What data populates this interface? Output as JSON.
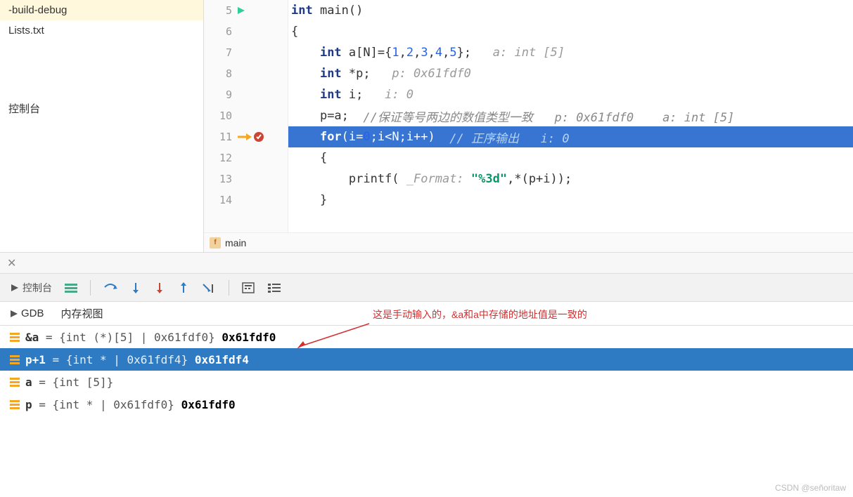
{
  "sidebar": {
    "items": [
      "-build-debug",
      "Lists.txt"
    ],
    "console_label": "控制台"
  },
  "code": {
    "lines": [
      {
        "num": 5,
        "indent": 0,
        "run": true,
        "parts": [
          {
            "t": "kw",
            "v": "int"
          },
          {
            "t": "",
            "v": " main()"
          }
        ]
      },
      {
        "num": 6,
        "indent": 0,
        "parts": [
          {
            "t": "",
            "v": "{"
          }
        ]
      },
      {
        "num": 7,
        "indent": 1,
        "parts": [
          {
            "t": "kw",
            "v": "int"
          },
          {
            "t": "",
            "v": " a[N]={"
          },
          {
            "t": "num",
            "v": "1"
          },
          {
            "t": "",
            "v": ","
          },
          {
            "t": "num",
            "v": "2"
          },
          {
            "t": "",
            "v": ","
          },
          {
            "t": "num",
            "v": "3"
          },
          {
            "t": "",
            "v": ","
          },
          {
            "t": "num",
            "v": "4"
          },
          {
            "t": "",
            "v": ","
          },
          {
            "t": "num",
            "v": "5"
          },
          {
            "t": "",
            "v": "};   "
          },
          {
            "t": "hint",
            "v": "a: int [5]"
          }
        ]
      },
      {
        "num": 8,
        "indent": 1,
        "parts": [
          {
            "t": "kw",
            "v": "int"
          },
          {
            "t": "",
            "v": " *p;   "
          },
          {
            "t": "hint",
            "v": "p: 0x61fdf0"
          }
        ]
      },
      {
        "num": 9,
        "indent": 1,
        "parts": [
          {
            "t": "kw",
            "v": "int"
          },
          {
            "t": "",
            "v": " i;   "
          },
          {
            "t": "hint",
            "v": "i: 0"
          }
        ]
      },
      {
        "num": 10,
        "indent": 1,
        "parts": [
          {
            "t": "",
            "v": "p=a;  "
          },
          {
            "t": "comment",
            "v": "//保证等号两边的数值类型一致   p: 0x61fdf0    a: int [5]"
          }
        ]
      },
      {
        "num": 11,
        "indent": 1,
        "current": true,
        "bp": true,
        "arrow": true,
        "parts": [
          {
            "t": "kw",
            "v": "for"
          },
          {
            "t": "",
            "v": "(i="
          },
          {
            "t": "num",
            "v": "0"
          },
          {
            "t": "",
            "v": ";i<N;i++)  "
          },
          {
            "t": "comment",
            "v": "// 正序输出   i: 0"
          }
        ]
      },
      {
        "num": 12,
        "indent": 1,
        "parts": [
          {
            "t": "",
            "v": "{"
          }
        ]
      },
      {
        "num": 13,
        "indent": 2,
        "parts": [
          {
            "t": "",
            "v": "printf( "
          },
          {
            "t": "param",
            "v": "_Format:"
          },
          {
            "t": "",
            "v": " "
          },
          {
            "t": "str",
            "v": "\"%3d\""
          },
          {
            "t": "",
            "v": ",*(p+i));"
          }
        ]
      },
      {
        "num": 14,
        "indent": 1,
        "parts": [
          {
            "t": "",
            "v": "}"
          }
        ]
      }
    ],
    "breadcrumb": "main"
  },
  "toolbar": {
    "console": "控制台"
  },
  "tabs": {
    "gdb": "GDB",
    "memory": "内存视图"
  },
  "annotation": "这是手动输入的，&a和a中存储的地址值是一致的",
  "watches": [
    {
      "name": "&a",
      "type": "{int (*)[5] | 0x61fdf0}",
      "value": "0x61fdf0",
      "selected": false
    },
    {
      "name": "p+1",
      "type": "{int * | 0x61fdf4}",
      "value": "0x61fdf4",
      "selected": true
    },
    {
      "name": "a",
      "type": "{int [5]}",
      "value": "",
      "selected": false
    },
    {
      "name": "p",
      "type": "{int * | 0x61fdf0}",
      "value": "0x61fdf0",
      "selected": false
    }
  ],
  "watermark": "CSDN @señoritaw"
}
